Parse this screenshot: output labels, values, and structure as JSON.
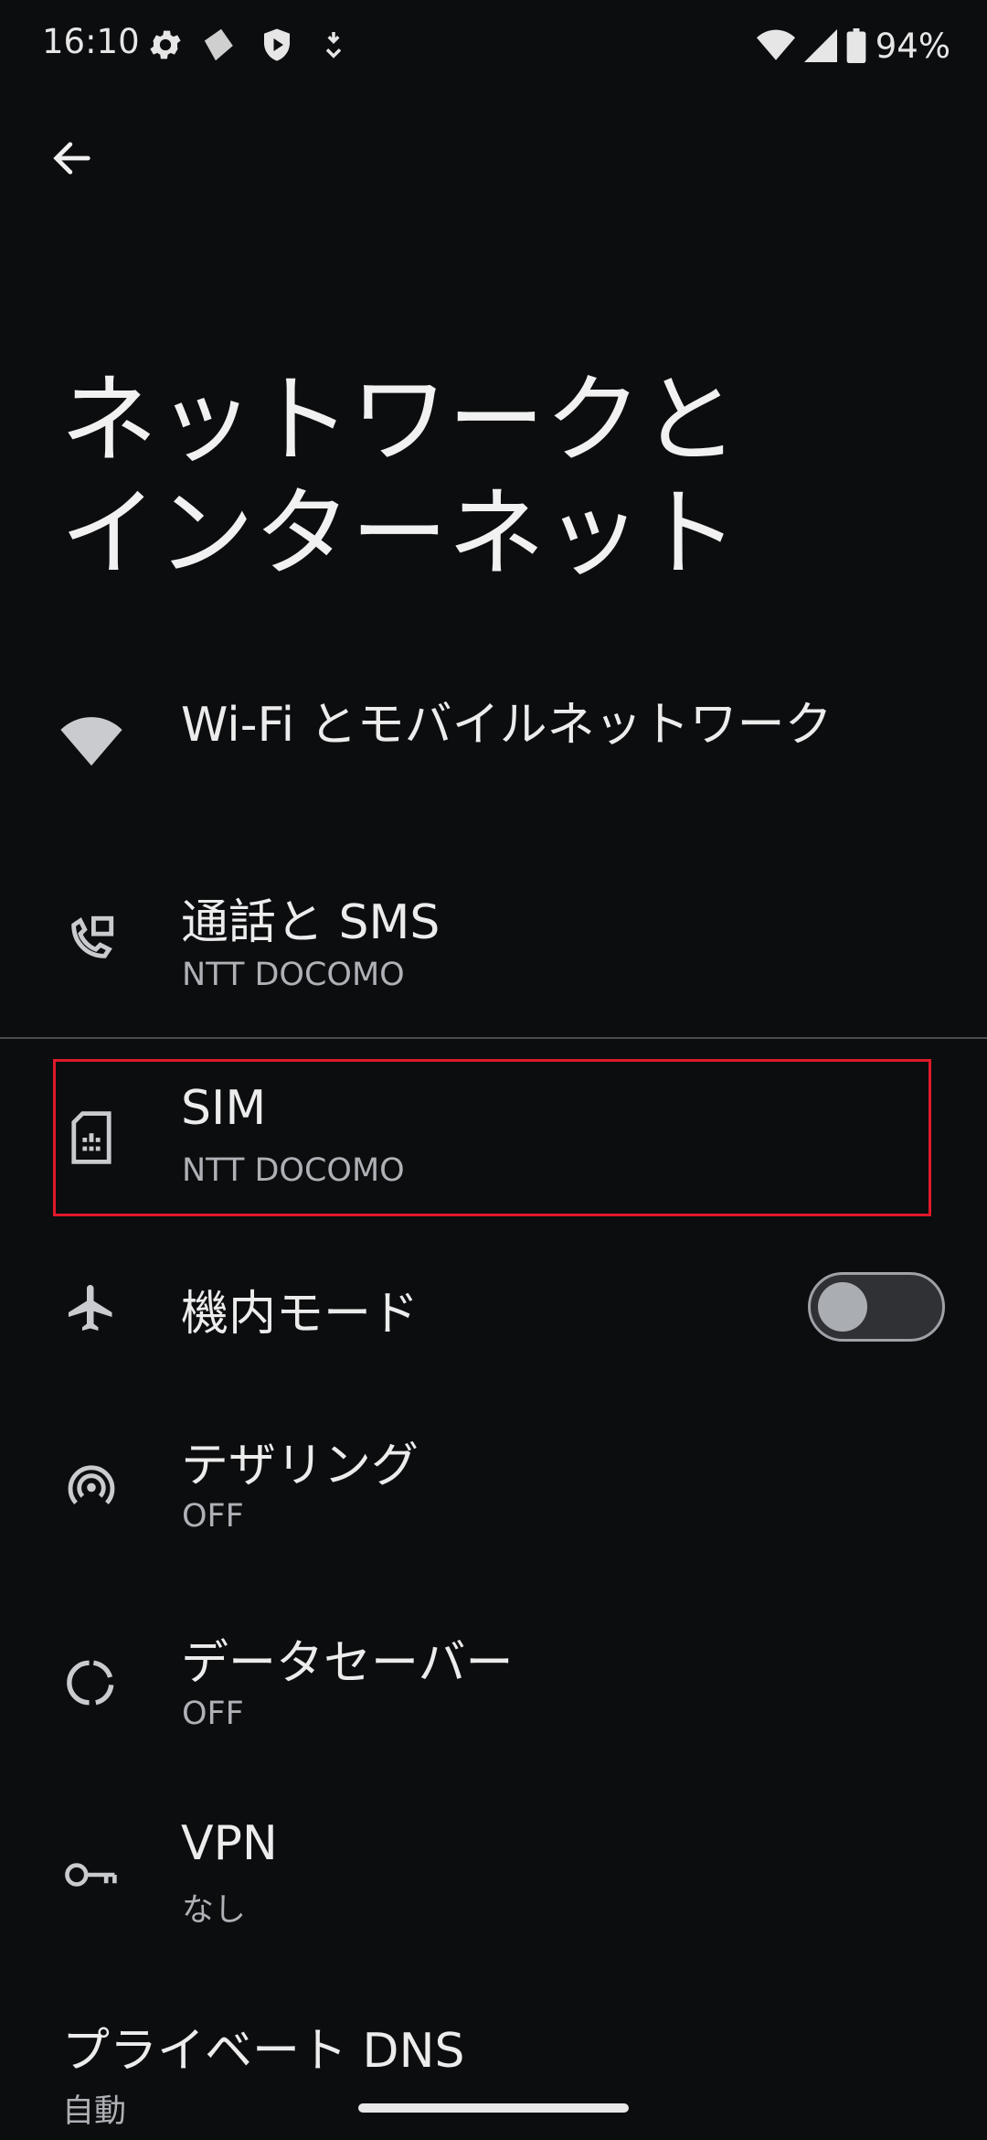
{
  "status_bar": {
    "time": "16:10",
    "battery_text": "94%",
    "left_icons": [
      "settings-gear-icon",
      "app-notification-icon",
      "shield-icon",
      "download-icon"
    ],
    "right_icons": [
      "wifi-icon",
      "signal-icon",
      "battery-icon"
    ]
  },
  "header": {
    "back_icon": "arrow-back-icon",
    "title_line1": "ネットワークと",
    "title_line2": "インターネット"
  },
  "items": {
    "wifi": {
      "icon": "wifi-icon",
      "title": "Wi-Fi とモバイルネットワーク"
    },
    "calls": {
      "icon": "call-sms-icon",
      "title": "通話と SMS",
      "subtitle": "NTT DOCOMO"
    },
    "sim": {
      "icon": "sim-card-icon",
      "title": "SIM",
      "subtitle": "NTT DOCOMO"
    },
    "airplane": {
      "icon": "airplane-icon",
      "title": "機内モード",
      "toggle_on": false
    },
    "tethering": {
      "icon": "hotspot-icon",
      "title": "テザリング",
      "subtitle": "OFF"
    },
    "datasaver": {
      "icon": "data-saver-icon",
      "title": "データセーバー",
      "subtitle": "OFF"
    },
    "vpn": {
      "icon": "vpn-key-icon",
      "title": "VPN",
      "subtitle": "なし"
    },
    "dns": {
      "title": "プライベート DNS",
      "subtitle": "自動"
    }
  },
  "colors": {
    "background": "#0c0d0f",
    "highlight_border": "#e0192a",
    "text_primary": "#ececec",
    "text_secondary": "#aeb1b5"
  }
}
